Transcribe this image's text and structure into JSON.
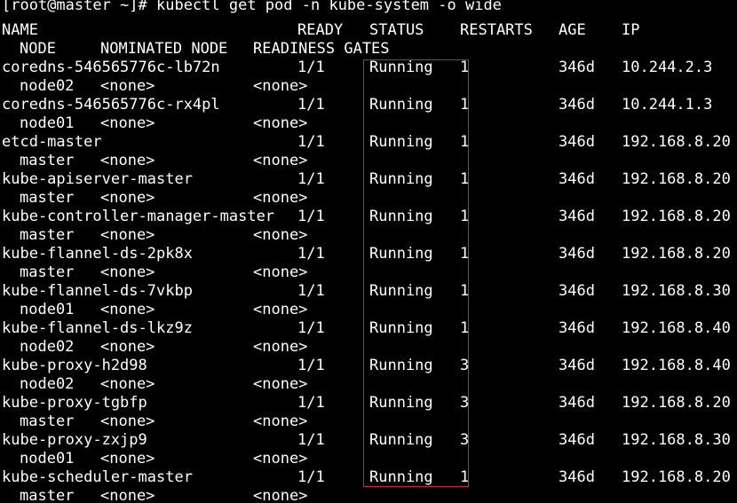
{
  "terminal": {
    "prompt": "[root@master ~]# kubectl get pod -n kube-system -o wide",
    "headers": {
      "name": "NAME",
      "ready": "READY",
      "status": "STATUS",
      "restarts": "RESTARTS",
      "age": "AGE",
      "ip": "IP",
      "node": "NODE",
      "nominated_node": "NOMINATED NODE",
      "readiness_gates": "READINESS GATES"
    },
    "highlight_color": "#d0262a",
    "rows": [
      {
        "name": "coredns-546565776c-lb72n",
        "ready": "1/1",
        "status": "Running",
        "restarts": "1",
        "age": "346d",
        "ip": "10.244.2.3",
        "node": "node02",
        "nominated": "<none>",
        "gates": "<none>"
      },
      {
        "name": "coredns-546565776c-rx4pl",
        "ready": "1/1",
        "status": "Running",
        "restarts": "1",
        "age": "346d",
        "ip": "10.244.1.3",
        "node": "node01",
        "nominated": "<none>",
        "gates": "<none>"
      },
      {
        "name": "etcd-master",
        "ready": "1/1",
        "status": "Running",
        "restarts": "1",
        "age": "346d",
        "ip": "192.168.8.20",
        "node": "master",
        "nominated": "<none>",
        "gates": "<none>"
      },
      {
        "name": "kube-apiserver-master",
        "ready": "1/1",
        "status": "Running",
        "restarts": "1",
        "age": "346d",
        "ip": "192.168.8.20",
        "node": "master",
        "nominated": "<none>",
        "gates": "<none>"
      },
      {
        "name": "kube-controller-manager-master",
        "ready": "1/1",
        "status": "Running",
        "restarts": "1",
        "age": "346d",
        "ip": "192.168.8.20",
        "node": "master",
        "nominated": "<none>",
        "gates": "<none>"
      },
      {
        "name": "kube-flannel-ds-2pk8x",
        "ready": "1/1",
        "status": "Running",
        "restarts": "1",
        "age": "346d",
        "ip": "192.168.8.20",
        "node": "master",
        "nominated": "<none>",
        "gates": "<none>"
      },
      {
        "name": "kube-flannel-ds-7vkbp",
        "ready": "1/1",
        "status": "Running",
        "restarts": "1",
        "age": "346d",
        "ip": "192.168.8.30",
        "node": "node01",
        "nominated": "<none>",
        "gates": "<none>"
      },
      {
        "name": "kube-flannel-ds-lkz9z",
        "ready": "1/1",
        "status": "Running",
        "restarts": "1",
        "age": "346d",
        "ip": "192.168.8.40",
        "node": "node02",
        "nominated": "<none>",
        "gates": "<none>"
      },
      {
        "name": "kube-proxy-h2d98",
        "ready": "1/1",
        "status": "Running",
        "restarts": "3",
        "age": "346d",
        "ip": "192.168.8.40",
        "node": "node02",
        "nominated": "<none>",
        "gates": "<none>"
      },
      {
        "name": "kube-proxy-tgbfp",
        "ready": "1/1",
        "status": "Running",
        "restarts": "3",
        "age": "346d",
        "ip": "192.168.8.20",
        "node": "master",
        "nominated": "<none>",
        "gates": "<none>"
      },
      {
        "name": "kube-proxy-zxjp9",
        "ready": "1/1",
        "status": "Running",
        "restarts": "3",
        "age": "346d",
        "ip": "192.168.8.30",
        "node": "node01",
        "nominated": "<none>",
        "gates": "<none>"
      },
      {
        "name": "kube-scheduler-master",
        "ready": "1/1",
        "status": "Running",
        "restarts": "1",
        "age": "346d",
        "ip": "192.168.8.20",
        "node": "master",
        "nominated": "<none>",
        "gates": "<none>"
      }
    ]
  }
}
